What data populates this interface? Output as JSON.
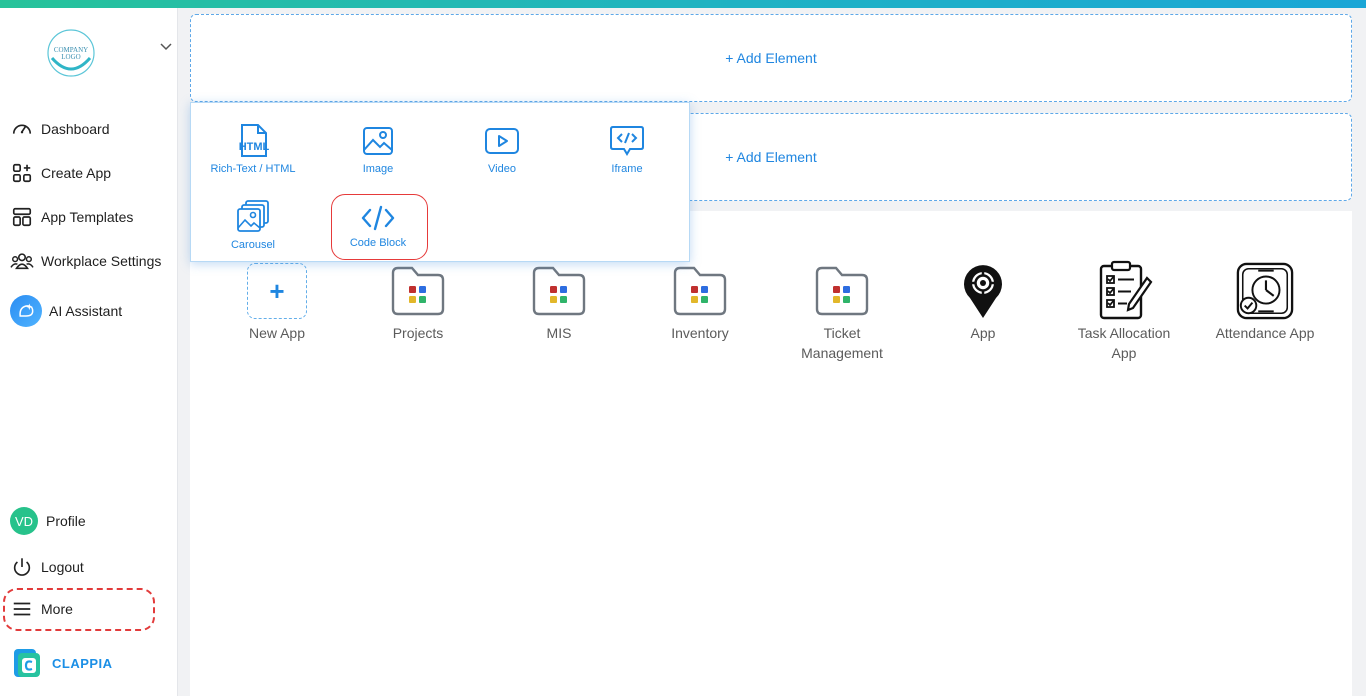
{
  "sidebar": {
    "logo_text": "COMPANY LOGO",
    "nav": [
      {
        "label": "Dashboard",
        "icon": "gauge-icon"
      },
      {
        "label": "Create App",
        "icon": "grid-plus-icon"
      },
      {
        "label": "App Templates",
        "icon": "template-icon"
      },
      {
        "label": "Workplace Settings",
        "icon": "users-icon"
      },
      {
        "label": "AI Assistant",
        "icon": "ai-sparkle-icon"
      }
    ],
    "profile": {
      "initials": "VD",
      "label": "Profile"
    },
    "logout": {
      "label": "Logout",
      "icon": "power-icon"
    },
    "more": {
      "label": "More",
      "icon": "menu-icon"
    },
    "brand": "CLAPPIA"
  },
  "main": {
    "add_element_1": "+ Add Element",
    "add_element_2": "+ Add Element",
    "apps": [
      {
        "name": "New App",
        "icon": "plus-icon"
      },
      {
        "name": "Projects",
        "icon": "folder-icon"
      },
      {
        "name": "MIS",
        "icon": "folder-icon"
      },
      {
        "name": "Inventory",
        "icon": "folder-icon"
      },
      {
        "name": "Ticket Management",
        "icon": "folder-icon"
      },
      {
        "name": "App",
        "icon": "location-pin-icon"
      },
      {
        "name": "Task Allocation App",
        "icon": "clipboard-checklist-icon"
      },
      {
        "name": "Attendance App",
        "icon": "clock-attendance-icon"
      }
    ]
  },
  "element_popup": {
    "items": [
      {
        "label": "Rich-Text / HTML",
        "icon": "html-file-icon"
      },
      {
        "label": "Image",
        "icon": "image-icon"
      },
      {
        "label": "Video",
        "icon": "video-play-icon"
      },
      {
        "label": "Iframe",
        "icon": "iframe-code-icon"
      },
      {
        "label": "Carousel",
        "icon": "carousel-icon"
      },
      {
        "label": "Code Block",
        "icon": "code-brackets-icon"
      }
    ]
  },
  "colors": {
    "accent": "#1f86e0",
    "highlight": "#e23b3b",
    "avatar": "#27c28b"
  }
}
